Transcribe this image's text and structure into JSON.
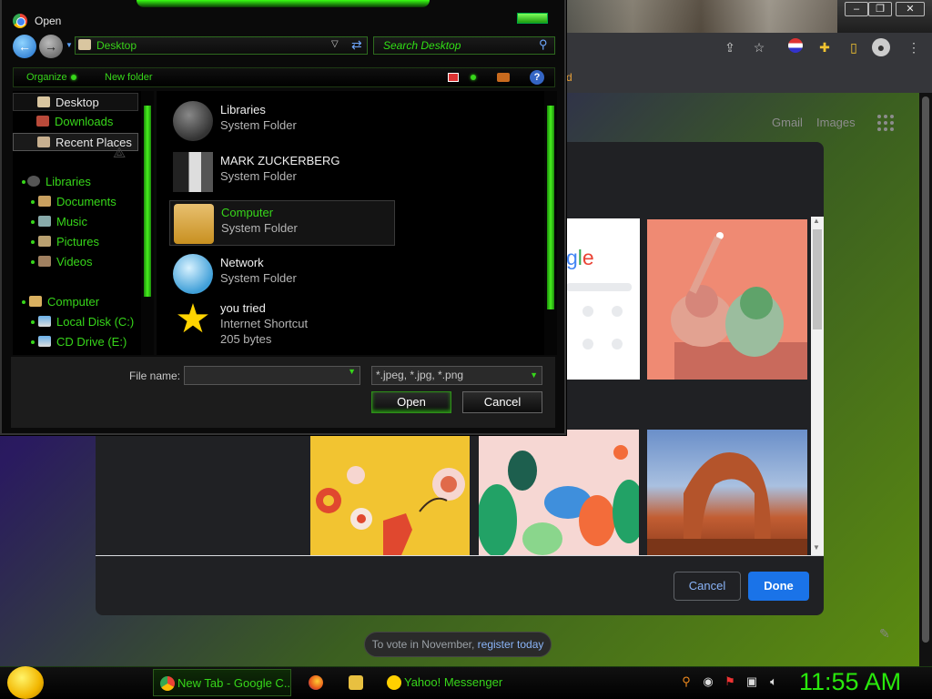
{
  "chrome_bg": {
    "top_links": [
      "Gmail",
      "Images"
    ],
    "vote_text": "To vote in November, ",
    "vote_link": "register today",
    "google_fragment": "gle",
    "bookmark_fragment": "d",
    "customize": {
      "cancel_label": "Cancel",
      "done_label": "Done"
    }
  },
  "dialog": {
    "title": "Open",
    "address": "Desktop",
    "search_placeholder": "Search Desktop",
    "toolbar": {
      "organize": "Organize",
      "new_folder": "New folder",
      "help": "?"
    },
    "nav": [
      {
        "label": "Desktop",
        "indent": 0,
        "color": "white",
        "selected": false
      },
      {
        "label": "Downloads",
        "indent": 0,
        "color": "green",
        "selected": false
      },
      {
        "label": "Recent Places",
        "indent": 0,
        "color": "white",
        "selected": true
      },
      {
        "label": "Libraries",
        "indent": 1,
        "color": "green",
        "selected": false
      },
      {
        "label": "Documents",
        "indent": 2,
        "color": "green",
        "selected": false
      },
      {
        "label": "Music",
        "indent": 2,
        "color": "green",
        "selected": false
      },
      {
        "label": "Pictures",
        "indent": 2,
        "color": "green",
        "selected": false
      },
      {
        "label": "Videos",
        "indent": 2,
        "color": "green",
        "selected": false
      },
      {
        "label": "Computer",
        "indent": 1,
        "color": "green",
        "selected": false
      },
      {
        "label": "Local Disk (C:)",
        "indent": 2,
        "color": "green",
        "selected": false
      },
      {
        "label": "CD Drive (E:)",
        "indent": 2,
        "color": "green",
        "selected": false
      }
    ],
    "files": [
      {
        "name": "Libraries",
        "type": "System Folder",
        "size": "",
        "icon": "libraries-icon",
        "selected": false
      },
      {
        "name": "MARK ZUCKERBERG",
        "type": "System Folder",
        "size": "",
        "icon": "user-folder-icon",
        "selected": false
      },
      {
        "name": "Computer",
        "type": "System Folder",
        "size": "",
        "icon": "computer-icon",
        "selected": true
      },
      {
        "name": "Network",
        "type": "System Folder",
        "size": "",
        "icon": "network-icon",
        "selected": false
      },
      {
        "name": "you tried",
        "type": "Internet Shortcut",
        "size": "205 bytes",
        "icon": "star-shortcut-icon",
        "selected": false
      }
    ],
    "file_name_label": "File name:",
    "file_name_value": "",
    "file_type": "*.jpeg, *.jpg, *.png",
    "open_label": "Open",
    "cancel_label": "Cancel"
  },
  "taskbar": {
    "tasks": [
      {
        "label": "New Tab - Google C...",
        "icon": "chrome-icon",
        "active": true
      },
      {
        "label": "",
        "icon": "firefox-icon",
        "active": false
      },
      {
        "label": "",
        "icon": "folder-icon",
        "active": false
      },
      {
        "label": "Yahoo! Messenger",
        "icon": "yahoo-messenger-icon",
        "active": false
      }
    ],
    "clock": "11:55 AM"
  },
  "colors": {
    "accent_green": "#37d61a",
    "clock_green": "#29e80c",
    "done_blue": "#1a73e8",
    "link_blue": "#8ab4f8"
  }
}
